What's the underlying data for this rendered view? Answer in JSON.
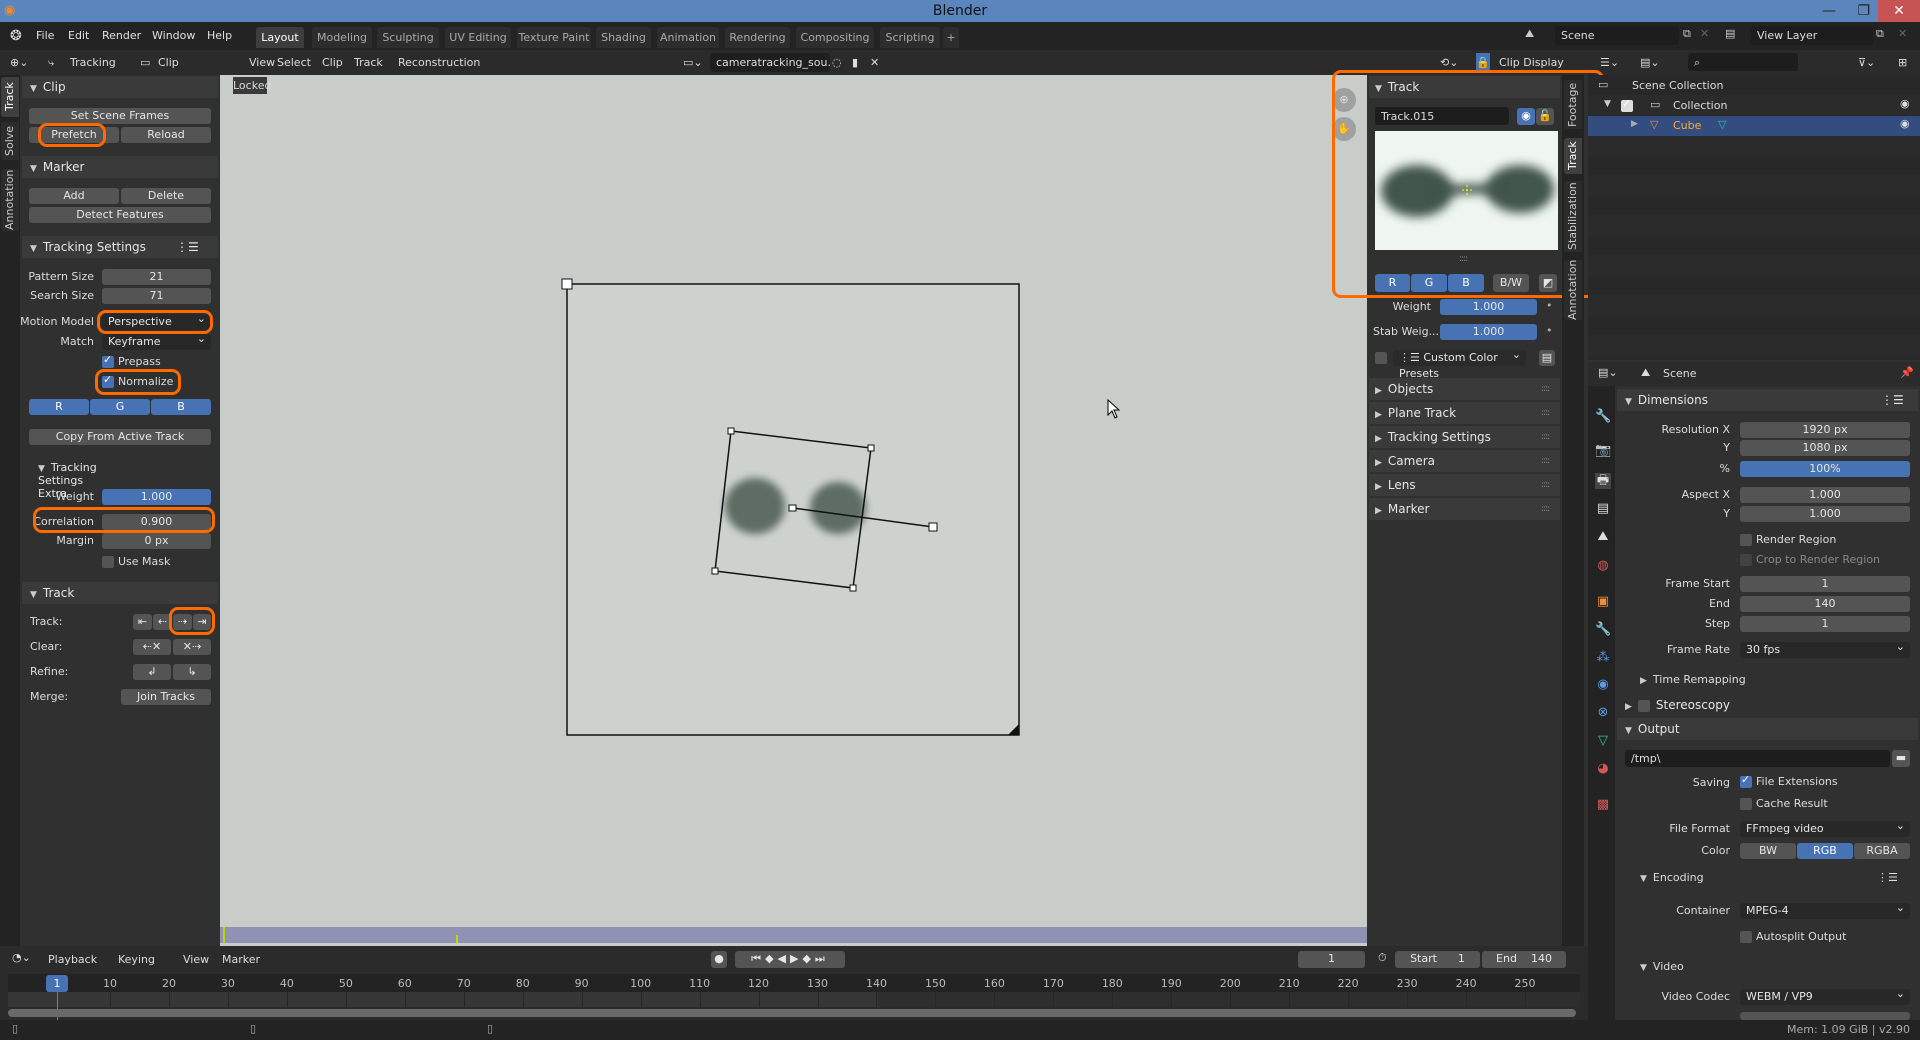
{
  "window": {
    "title": "Blender"
  },
  "menu": [
    "File",
    "Edit",
    "Render",
    "Window",
    "Help"
  ],
  "workspaces": [
    {
      "label": "Layout",
      "active": true
    },
    {
      "label": "Modeling"
    },
    {
      "label": "Sculpting"
    },
    {
      "label": "UV Editing"
    },
    {
      "label": "Texture Paint"
    },
    {
      "label": "Shading"
    },
    {
      "label": "Animation"
    },
    {
      "label": "Rendering"
    },
    {
      "label": "Compositing"
    },
    {
      "label": "Scripting"
    },
    {
      "label": "+"
    }
  ],
  "scene": {
    "name": "Scene",
    "view_layer": "View Layer"
  },
  "clip_header": {
    "mode": "Tracking",
    "view": "Clip",
    "menus": [
      "View",
      "Select",
      "Clip",
      "Track",
      "Reconstruction"
    ],
    "clip_name": "cameratracking_sou...",
    "display": "Clip Display"
  },
  "left_tabs": [
    "Track",
    "Solve",
    "Annotation"
  ],
  "left": {
    "clip": {
      "title": "Clip",
      "set_scene_frames": "Set Scene Frames",
      "prefetch": "Prefetch",
      "reload": "Reload"
    },
    "marker": {
      "title": "Marker",
      "add": "Add",
      "delete": "Delete",
      "detect": "Detect Features"
    },
    "tracking_settings": {
      "title": "Tracking Settings",
      "pattern_size_label": "Pattern Size",
      "pattern_size": "21",
      "search_size_label": "Search Size",
      "search_size": "71",
      "motion_model_label": "Motion Model",
      "motion_model": "Perspective",
      "match_label": "Match",
      "match": "Keyframe",
      "prepass": "Prepass",
      "prepass_checked": true,
      "normalize": "Normalize",
      "normalize_checked": true,
      "r": "R",
      "g": "G",
      "b": "B",
      "copy": "Copy From Active Track"
    },
    "extra": {
      "title": "Tracking Settings Extra",
      "weight_label": "Weight",
      "weight": "1.000",
      "correlation_label": "Correlation",
      "correlation": "0.900",
      "margin_label": "Margin",
      "margin": "0 px",
      "use_mask": "Use Mask",
      "use_mask_checked": false
    },
    "track": {
      "title": "Track",
      "track_label": "Track:",
      "clear_label": "Clear:",
      "refine_label": "Refine:",
      "merge_label": "Merge:",
      "join": "Join Tracks"
    }
  },
  "viewport": {
    "locked": "Locked"
  },
  "sidebar": {
    "track_title": "Track",
    "track_name": "Track.015",
    "r": "R",
    "g": "G",
    "b": "B",
    "bw": "B/W",
    "weight_label": "Weight",
    "weight": "1.000",
    "stab_label": "Stab Weig...",
    "stab": "1.000",
    "presets": "Custom Color Presets",
    "collapsed": [
      "Objects",
      "Plane Track",
      "Tracking Settings",
      "Camera",
      "Lens",
      "Marker"
    ],
    "tabs": [
      "Footage",
      "Track",
      "Stabilization",
      "Annotation"
    ]
  },
  "outliner": {
    "scene_collection": "Scene Collection",
    "collection": "Collection",
    "object": "Cube"
  },
  "properties": {
    "context": "Scene",
    "dimensions": "Dimensions",
    "res_x_label": "Resolution X",
    "res_x": "1920 px",
    "res_y_label": "Y",
    "res_y": "1080 px",
    "pct_label": "%",
    "pct": "100%",
    "aspect_x_label": "Aspect X",
    "aspect_x": "1.000",
    "aspect_y_label": "Y",
    "aspect_y": "1.000",
    "render_region": "Render Region",
    "crop": "Crop to Render Region",
    "frame_start_label": "Frame Start",
    "frame_start": "1",
    "end_label": "End",
    "end": "140",
    "step_label": "Step",
    "step": "1",
    "frame_rate_label": "Frame Rate",
    "frame_rate": "30 fps",
    "time_remapping": "Time Remapping",
    "stereoscopy": "Stereoscopy",
    "output": "Output",
    "path": "/tmp\\",
    "saving_label": "Saving",
    "file_extensions": "File Extensions",
    "cache_result": "Cache Result",
    "file_format_label": "File Format",
    "file_format": "FFmpeg video",
    "color_label": "Color",
    "color_bw": "BW",
    "color_rgb": "RGB",
    "color_rgba": "RGBA",
    "encoding": "Encoding",
    "container_label": "Container",
    "container": "MPEG-4",
    "autosplit": "Autosplit Output",
    "video": "Video",
    "codec_label": "Video Codec",
    "codec": "WEBM / VP9"
  },
  "timeline": {
    "menus": [
      "Playback",
      "Keying",
      "View",
      "Marker"
    ],
    "current_frame": "1",
    "start_label": "Start",
    "start": "1",
    "end_label": "End",
    "end": "140",
    "ticks": [
      "10",
      "20",
      "30",
      "40",
      "50",
      "60",
      "70",
      "80",
      "90",
      "100",
      "110",
      "120",
      "130",
      "140",
      "150",
      "160",
      "170",
      "180",
      "190",
      "200",
      "210",
      "220",
      "230",
      "240",
      "250"
    ]
  },
  "status": {
    "memory": "Mem: 1.09 GiB | v2.90"
  },
  "colors": {
    "accent": "#4772b3",
    "highlight": "#ff6a00",
    "title_bar": "#5a86bd"
  }
}
